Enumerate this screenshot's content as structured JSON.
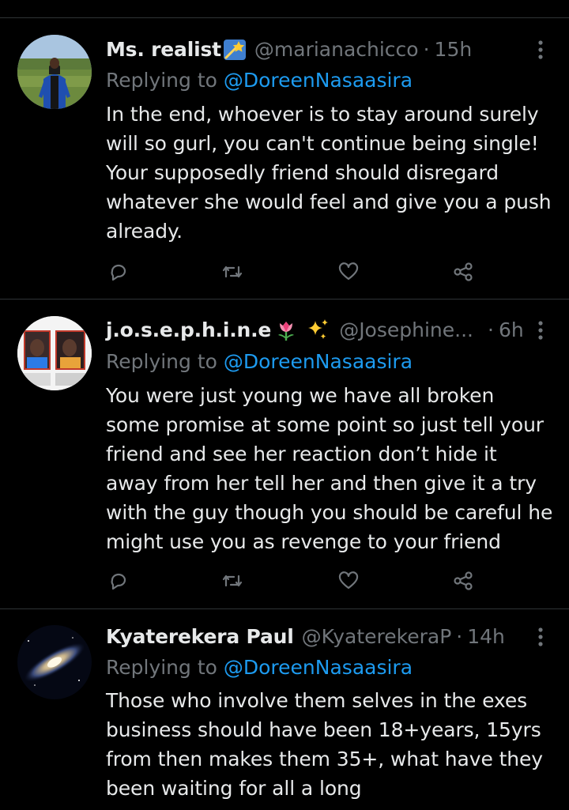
{
  "colors": {
    "background": "#000000",
    "text": "#e7e9ea",
    "secondary": "#71767b",
    "link": "#1d9bf0",
    "divider": "#2f3336"
  },
  "tweets": [
    {
      "display_name": "Ms. realist",
      "badge_icon": "shooting-star-emoji",
      "handle": "@marianachicco",
      "separator": "·",
      "time": "15h",
      "replying_prefix": "Replying to ",
      "replying_to": "@DoreenNasaasira",
      "lines": [
        "In the end, whoever is to stay around surely",
        "will so gurl, you can't continue being single!",
        "Your supposedly friend should disregard",
        "whatever she would feel and give you a push",
        "already."
      ]
    },
    {
      "display_name": "j.o.s.e.p.h.i.n.e",
      "badge_icon": "tulip-sparkles-emoji",
      "handle": "@Josephine...",
      "separator": "·",
      "time": "6h",
      "replying_prefix": "Replying to ",
      "replying_to": "@DoreenNasaasira",
      "lines": [
        "You were just young we have all broken",
        "some promise at some point so just tell your",
        "friend and see her reaction don’t hide it",
        "away from her tell her and then give it a try",
        "with the guy though you should be careful he",
        "might use you as revenge to your friend"
      ]
    },
    {
      "display_name": "Kyaterekera Paul",
      "badge_icon": "",
      "handle": "@KyaterekeraP",
      "separator": "·",
      "time": "14h",
      "replying_prefix": "Replying to ",
      "replying_to": "@DoreenNasaasira",
      "lines": [
        "Those who involve them selves in the exes",
        "business should have been 18+years, 15yrs",
        "from then makes them 35+, what have they",
        "been waiting for all a long"
      ]
    }
  ]
}
